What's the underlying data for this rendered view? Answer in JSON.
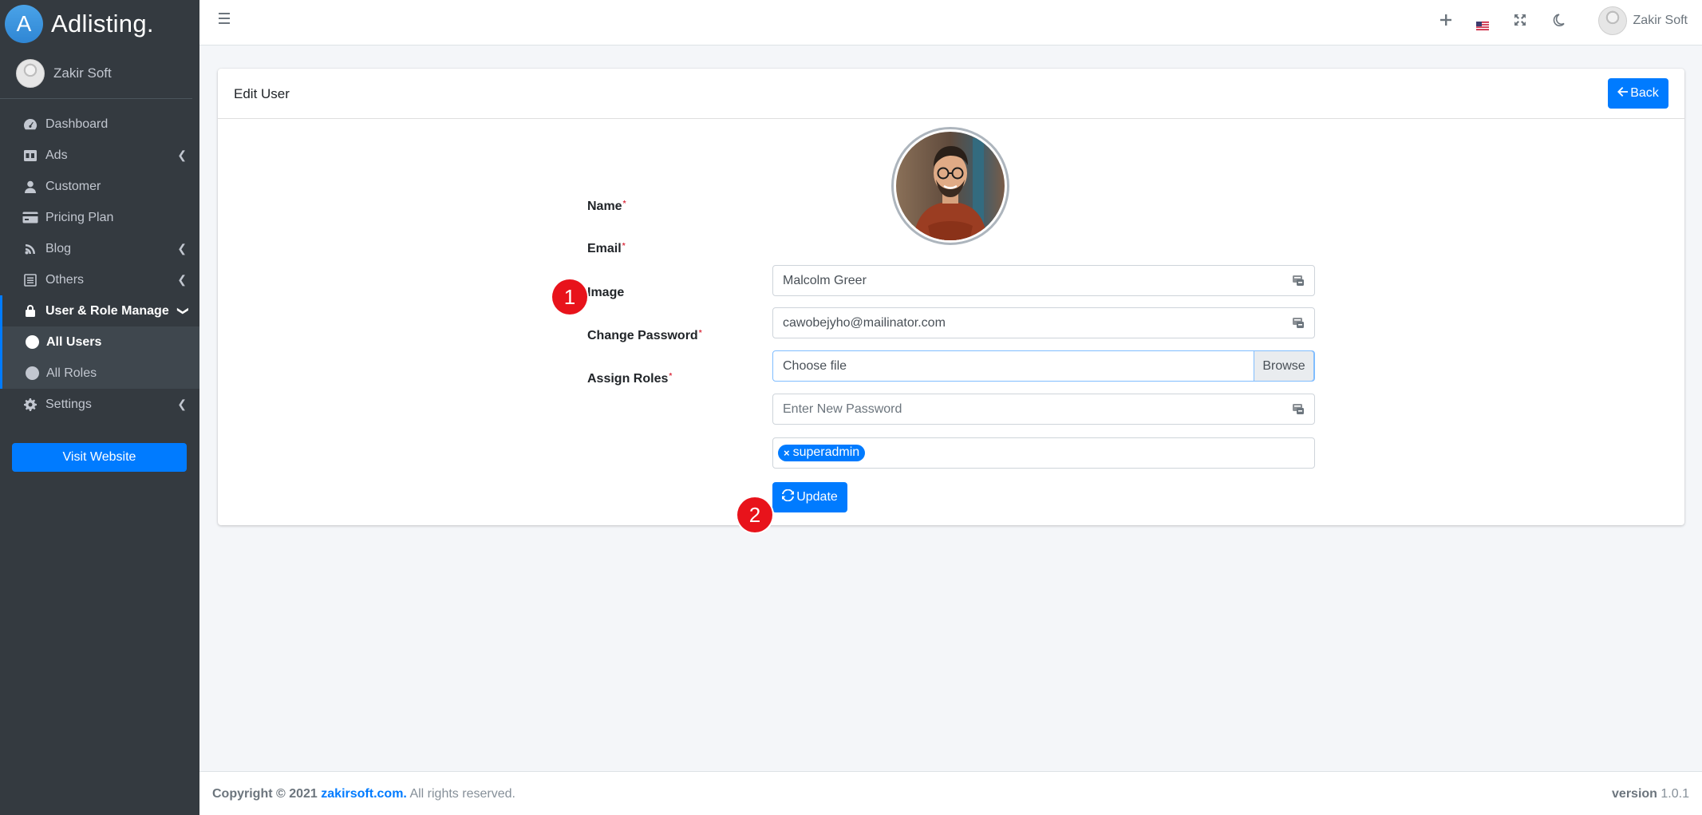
{
  "brand": {
    "logo_letter": "A",
    "name": "Adlisting."
  },
  "sidebar": {
    "user_name": "Zakir Soft",
    "items": [
      {
        "label": "Dashboard",
        "icon": "tachometer-icon"
      },
      {
        "label": "Ads",
        "icon": "ad-icon"
      },
      {
        "label": "Customer",
        "icon": "user-icon"
      },
      {
        "label": "Pricing Plan",
        "icon": "credit-card-icon"
      },
      {
        "label": "Blog",
        "icon": "blog-icon"
      },
      {
        "label": "Others",
        "icon": "list-icon"
      },
      {
        "label": "User & Role Manage",
        "icon": "lock-icon"
      },
      {
        "label": "Settings",
        "icon": "gear-icon"
      }
    ],
    "sub_items": [
      {
        "label": "All Users"
      },
      {
        "label": "All Roles"
      }
    ],
    "visit_label": "Visit Website"
  },
  "topbar": {
    "user_name": "Zakir Soft"
  },
  "card": {
    "title": "Edit User",
    "back_label": "Back"
  },
  "form": {
    "name_label": "Name",
    "name_value": "Malcolm Greer",
    "email_label": "Email",
    "email_value": "cawobejyho@mailinator.com",
    "image_label": "Image",
    "image_value": "Choose file",
    "browse_label": "Browse",
    "password_label": "Change Password",
    "password_placeholder": "Enter New Password",
    "roles_label": "Assign Roles",
    "roles": [
      "superadmin"
    ],
    "update_label": "Update"
  },
  "markers": [
    "1",
    "2"
  ],
  "footer": {
    "copyright": "Copyright © 2021",
    "site": "zakirsoft.com.",
    "rights": "All rights reserved.",
    "version_label": "version",
    "version_value": "1.0.1"
  },
  "colors": {
    "primary": "#007bff",
    "sidebar": "#343a40",
    "marker": "#e8131b"
  }
}
